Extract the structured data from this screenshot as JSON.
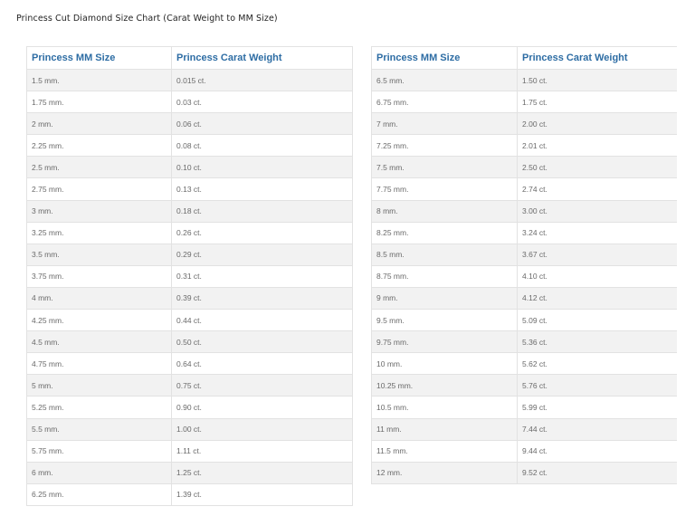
{
  "title": "Princess Cut Diamond Size Chart (Carat Weight to MM Size)",
  "tables": [
    {
      "headers": [
        "Princess MM Size",
        "Princess Carat Weight"
      ],
      "rows": [
        [
          "1.5 mm.",
          "0.015 ct."
        ],
        [
          "1.75 mm.",
          "0.03 ct."
        ],
        [
          "2 mm.",
          "0.06 ct."
        ],
        [
          "2.25 mm.",
          "0.08 ct."
        ],
        [
          "2.5 mm.",
          "0.10 ct."
        ],
        [
          "2.75 mm.",
          "0.13 ct."
        ],
        [
          "3 mm.",
          "0.18 ct."
        ],
        [
          "3.25 mm.",
          "0.26 ct."
        ],
        [
          "3.5 mm.",
          "0.29 ct."
        ],
        [
          "3.75 mm.",
          "0.31 ct."
        ],
        [
          "4 mm.",
          "0.39 ct."
        ],
        [
          "4.25 mm.",
          "0.44 ct."
        ],
        [
          "4.5 mm.",
          "0.50 ct."
        ],
        [
          "4.75 mm.",
          "0.64 ct."
        ],
        [
          "5 mm.",
          "0.75 ct."
        ],
        [
          "5.25 mm.",
          "0.90 ct."
        ],
        [
          "5.5 mm.",
          "1.00 ct."
        ],
        [
          "5.75 mm.",
          "1.11 ct."
        ],
        [
          "6 mm.",
          "1.25 ct."
        ],
        [
          "6.25 mm.",
          "1.39 ct."
        ]
      ]
    },
    {
      "headers": [
        "Princess MM Size",
        "Princess Carat Weight"
      ],
      "rows": [
        [
          "6.5 mm.",
          "1.50 ct."
        ],
        [
          "6.75 mm.",
          "1.75 ct."
        ],
        [
          "7 mm.",
          "2.00 ct."
        ],
        [
          "7.25 mm.",
          "2.01 ct."
        ],
        [
          "7.5 mm.",
          "2.50 ct."
        ],
        [
          "7.75 mm.",
          "2.74 ct."
        ],
        [
          "8 mm.",
          "3.00 ct."
        ],
        [
          "8.25 mm.",
          "3.24 ct."
        ],
        [
          "8.5 mm.",
          "3.67 ct."
        ],
        [
          "8.75 mm.",
          "4.10 ct."
        ],
        [
          "9 mm.",
          "4.12 ct."
        ],
        [
          "9.5 mm.",
          "5.09 ct."
        ],
        [
          "9.75 mm.",
          "5.36 ct."
        ],
        [
          "10 mm.",
          "5.62 ct."
        ],
        [
          "10.25 mm.",
          "5.76 ct."
        ],
        [
          "10.5 mm.",
          "5.99 ct."
        ],
        [
          "11 mm.",
          "7.44 ct."
        ],
        [
          "11.5 mm.",
          "9.44 ct."
        ],
        [
          "12 mm.",
          "9.52 ct."
        ]
      ]
    }
  ]
}
